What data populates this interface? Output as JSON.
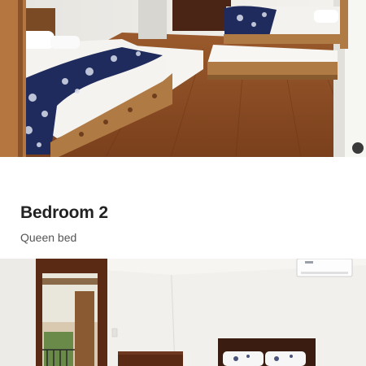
{
  "room": {
    "title": "Bedroom 2",
    "subtitle": "Queen bed"
  },
  "images": {
    "top_photo": "bedroom-with-two-beds-photo",
    "bottom_photo": "bedroom-with-door-and-ac-photo"
  },
  "colors": {
    "floor": "#8a4a22",
    "wall": "#eeeeec",
    "bedspread": "#1f2b5c",
    "wood": "#b07a45"
  }
}
